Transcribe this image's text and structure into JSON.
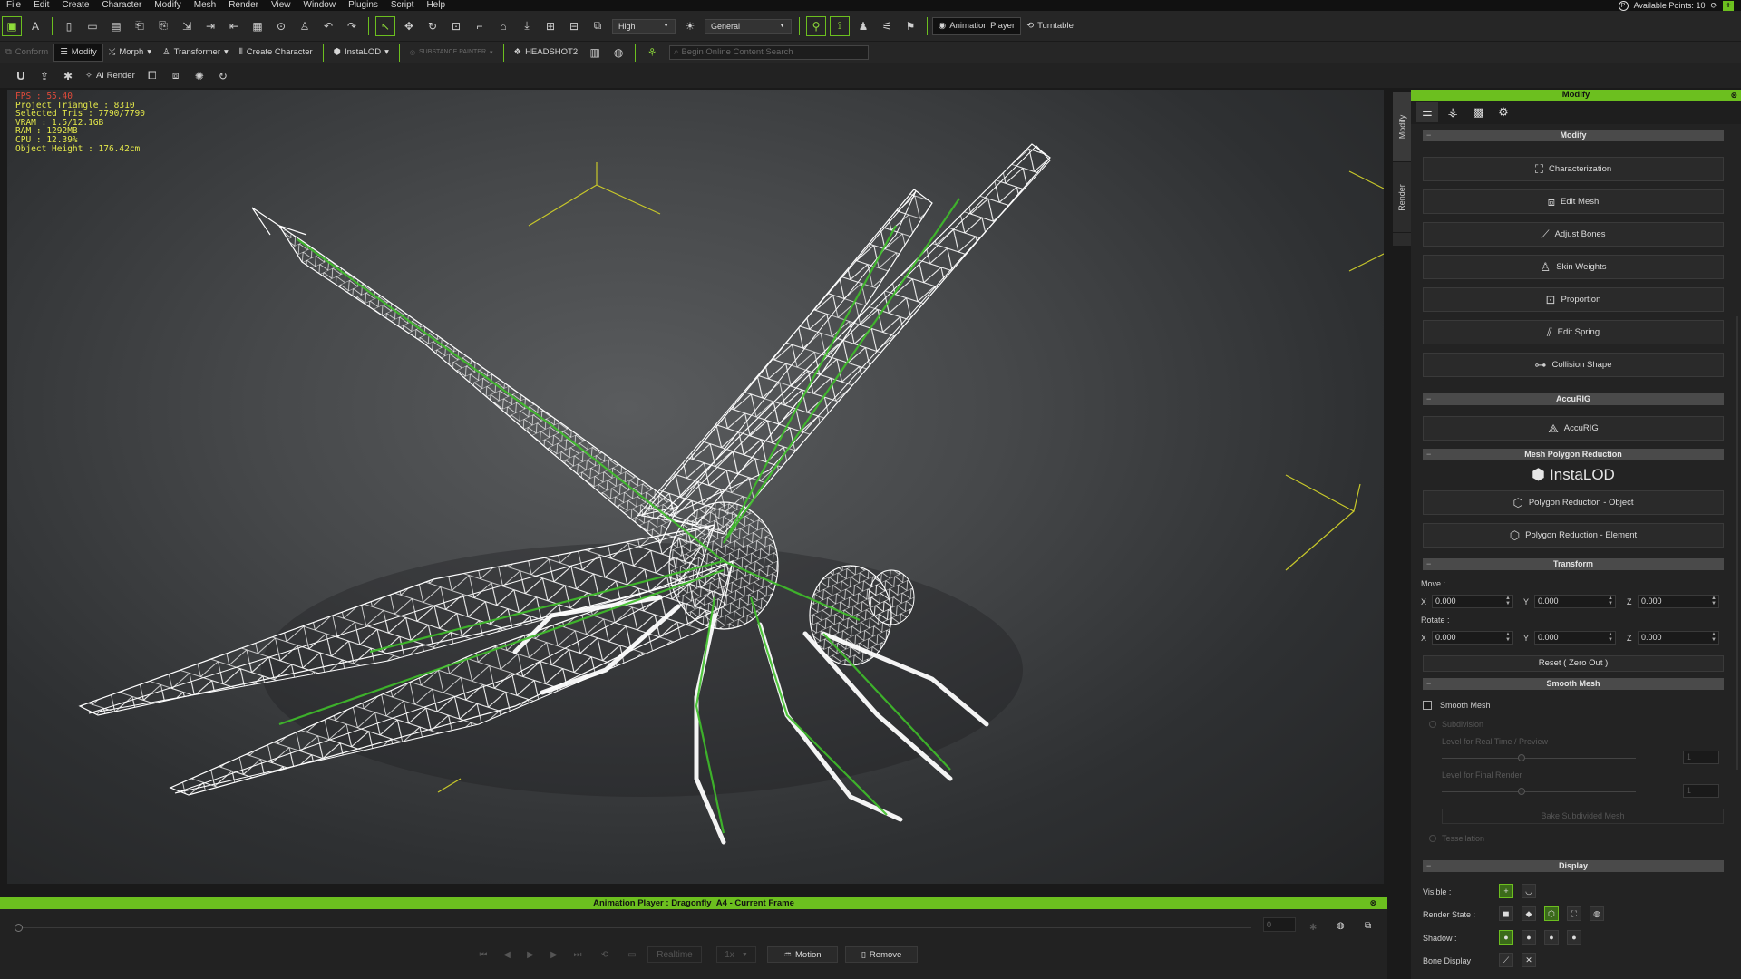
{
  "menu": [
    "File",
    "Edit",
    "Create",
    "Character",
    "Modify",
    "Mesh",
    "Render",
    "View",
    "Window",
    "Plugins",
    "Script",
    "Help"
  ],
  "header_right": {
    "points_label": "Available Points: 10",
    "plus": "+"
  },
  "toolbar": {
    "quality_dd": "High",
    "view_dd": "General",
    "animation_player": "Animation Player",
    "turntable": "Turntable"
  },
  "toolbar2": {
    "conform": "Conform",
    "modify": "Modify",
    "morph": "Morph",
    "transformer": "Transformer",
    "create_character": "Create Character",
    "instalod": "InstaLOD",
    "substance": "SUBSTANCE PAINTER",
    "headshot": "HEADSHOT2",
    "search_placeholder": "Begin Online Content Search"
  },
  "toolbar3": {
    "u": "U",
    "ai_render": "AI Render"
  },
  "stats": {
    "fps": "FPS : 55.40",
    "project_tri": "Project Triangle : 8310",
    "selected_tri": "Selected Tris : 7790/7790",
    "vram": "VRAM : 1.5/12.1GB",
    "ram": "RAM : 1292MB",
    "cpu": "CPU : 12.39%",
    "object_height": "Object Height : 176.42cm"
  },
  "side_tabs": {
    "modify": "Modify",
    "render": "Render"
  },
  "panel": {
    "title": "Modify",
    "sec_modify": "Modify",
    "btn_characterization": "Characterization",
    "btn_edit_mesh": "Edit Mesh",
    "btn_adjust_bones": "Adjust Bones",
    "btn_skin_weights": "Skin Weights",
    "btn_proportion": "Proportion",
    "btn_edit_spring": "Edit Spring",
    "btn_collision_shape": "Collision Shape",
    "sec_accurig": "AccuRIG",
    "btn_accurig": "AccuRIG",
    "sec_polyred": "Mesh Polygon Reduction",
    "instalod_logo": "InstaLOD",
    "btn_polyred_object": "Polygon Reduction - Object",
    "btn_polyred_element": "Polygon Reduction - Element",
    "sec_transform": "Transform",
    "move_label": "Move :",
    "rotate_label": "Rotate :",
    "axis_x": "X",
    "axis_y": "Y",
    "axis_z": "Z",
    "move_x": "0.000",
    "move_y": "0.000",
    "move_z": "0.000",
    "rot_x": "0.000",
    "rot_y": "0.000",
    "rot_z": "0.000",
    "reset": "Reset ( Zero Out )",
    "sec_smooth": "Smooth Mesh",
    "smooth_mesh": "Smooth Mesh",
    "subdivision": "Subdivision",
    "level_realtime": "Level for Real Time / Preview",
    "level_final": "Level for Final Render",
    "level_val1": "1",
    "level_val2": "1",
    "bake_btn": "Bake Subdivided Mesh",
    "tessellation": "Tessellation",
    "sec_display": "Display",
    "visible": "Visible :",
    "render_state": "Render State :",
    "shadow": "Shadow :",
    "bone_display": "Bone Display"
  },
  "anim": {
    "title": "Animation Player : Dragonfly_A4 - Current Frame",
    "frame": "0",
    "realtime": "Realtime",
    "speed": "1x",
    "motion": "Motion",
    "remove": "Remove"
  },
  "colors": {
    "accent": "#6cbf1f",
    "stats": "#e4e84a",
    "fps": "#e04a3a",
    "wire": "#ffffff",
    "bone": "#3fbf2a"
  }
}
